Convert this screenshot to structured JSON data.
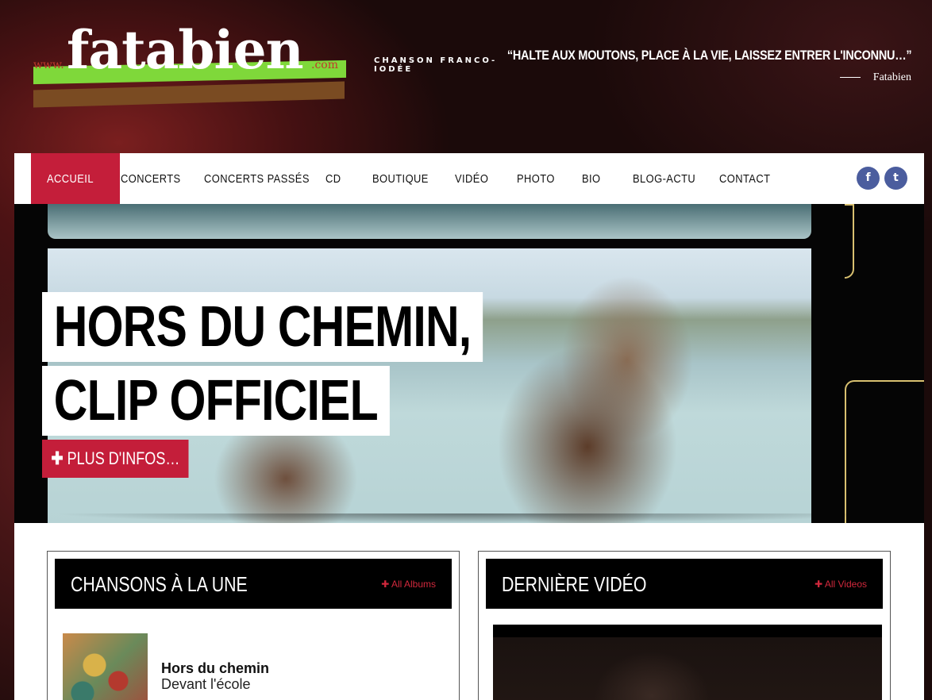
{
  "header": {
    "logo": {
      "word": "fatabien",
      "prefix": "www.",
      "suffix": ".com"
    },
    "tagline": "CHANSON FRANCO-IODÉE",
    "quote": "“HALTE AUX MOUTONS, PLACE À LA VIE, LAISSEZ ENTRER L'INCONNU…”",
    "quote_author": "Fatabien"
  },
  "nav": {
    "items": [
      "ACCUEIL",
      "CONCERTS",
      "CONCERTS PASSÉS",
      "CD",
      "BOUTIQUE",
      "VIDÉO",
      "PHOTO",
      "BIO",
      "BLOG-ACTU",
      "CONTACT"
    ],
    "active": "ACCUEIL",
    "social": {
      "facebook": "f",
      "twitter": "t"
    }
  },
  "hero": {
    "title_line1": "HORS DU CHEMIN,",
    "title_line2": "CLIP OFFICIEL",
    "cta": "PLUS D'INFOS…",
    "cta_icon": "plus-icon"
  },
  "songs_panel": {
    "title": "CHANSONS À LA UNE",
    "link": "All Albums",
    "song": {
      "title": "Hors du chemin",
      "subtitle": "Devant l'école"
    }
  },
  "video_panel": {
    "title": "DERNIÈRE VIDÉO",
    "link": "All Videos"
  },
  "colors": {
    "accent": "#c41e3a",
    "social": "#4b5d9e",
    "logo_green": "#7fd83a",
    "logo_brown": "#7a4b22"
  }
}
